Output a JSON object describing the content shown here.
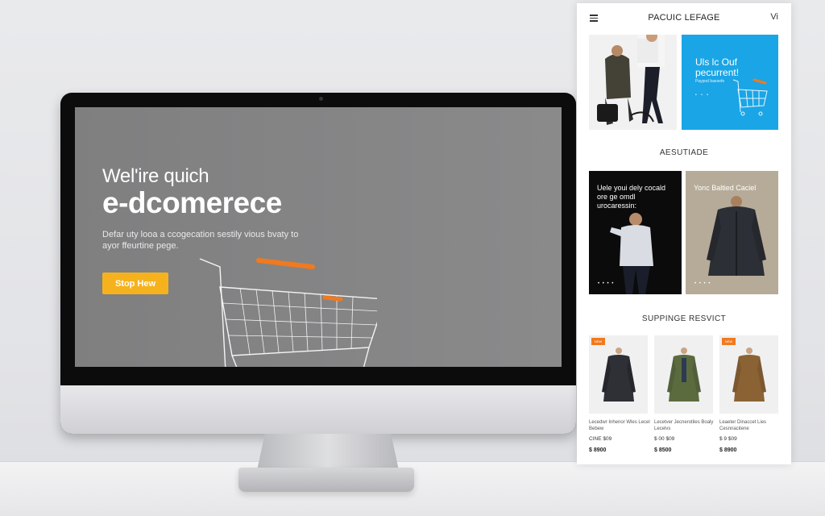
{
  "desktop_hero": {
    "title_line1": "Wel'ire quich",
    "title_line2": "e-dcomerece",
    "subtitle": "Defar uty looa a ccogecation sestily vious bvaty to ayor ffeurtine pege.",
    "cta_label": "Stop Hew"
  },
  "mobile": {
    "header": {
      "title": "PACUIC LEFAGE",
      "action_label": "Vi"
    },
    "hero_cards": [
      {
        "kind": "photo"
      },
      {
        "kind": "promo",
        "title": "Uls lc Ouf pecurrent!",
        "subtitle": "Paypod baesefe",
        "dots": "• • •"
      }
    ],
    "section1_title": "AESUTIADE",
    "promo_cards": [
      {
        "text": "Uele youi dely cocald ore ge omdl urocaressin:",
        "dots": "• • • •"
      },
      {
        "text": "Yonc Baltied Caciel",
        "dots": "• • • •"
      }
    ],
    "section2_title": "SUPPINGE RESVICT",
    "products": [
      {
        "badge": "NEW",
        "name": "Lecedwr Inhenor Wles Lecel Bebew",
        "price_old": "CINE $09",
        "price": "$ 8900"
      },
      {
        "badge": "",
        "name": "Lecetver Jecnerotiles Boaly Lecelvs",
        "price_old": "$ 00 $09",
        "price": "$ 8500"
      },
      {
        "badge": "NEW",
        "name": "Leaeter Dinaccet Lies Cesnnacitene",
        "price_old": "$ 9 $09",
        "price": "$ 8900"
      }
    ]
  },
  "colors": {
    "accent_yellow": "#f6b21d",
    "accent_blue": "#1aa5e6",
    "badge_orange": "#f07a1f",
    "cart_orange": "#f07a1f"
  }
}
